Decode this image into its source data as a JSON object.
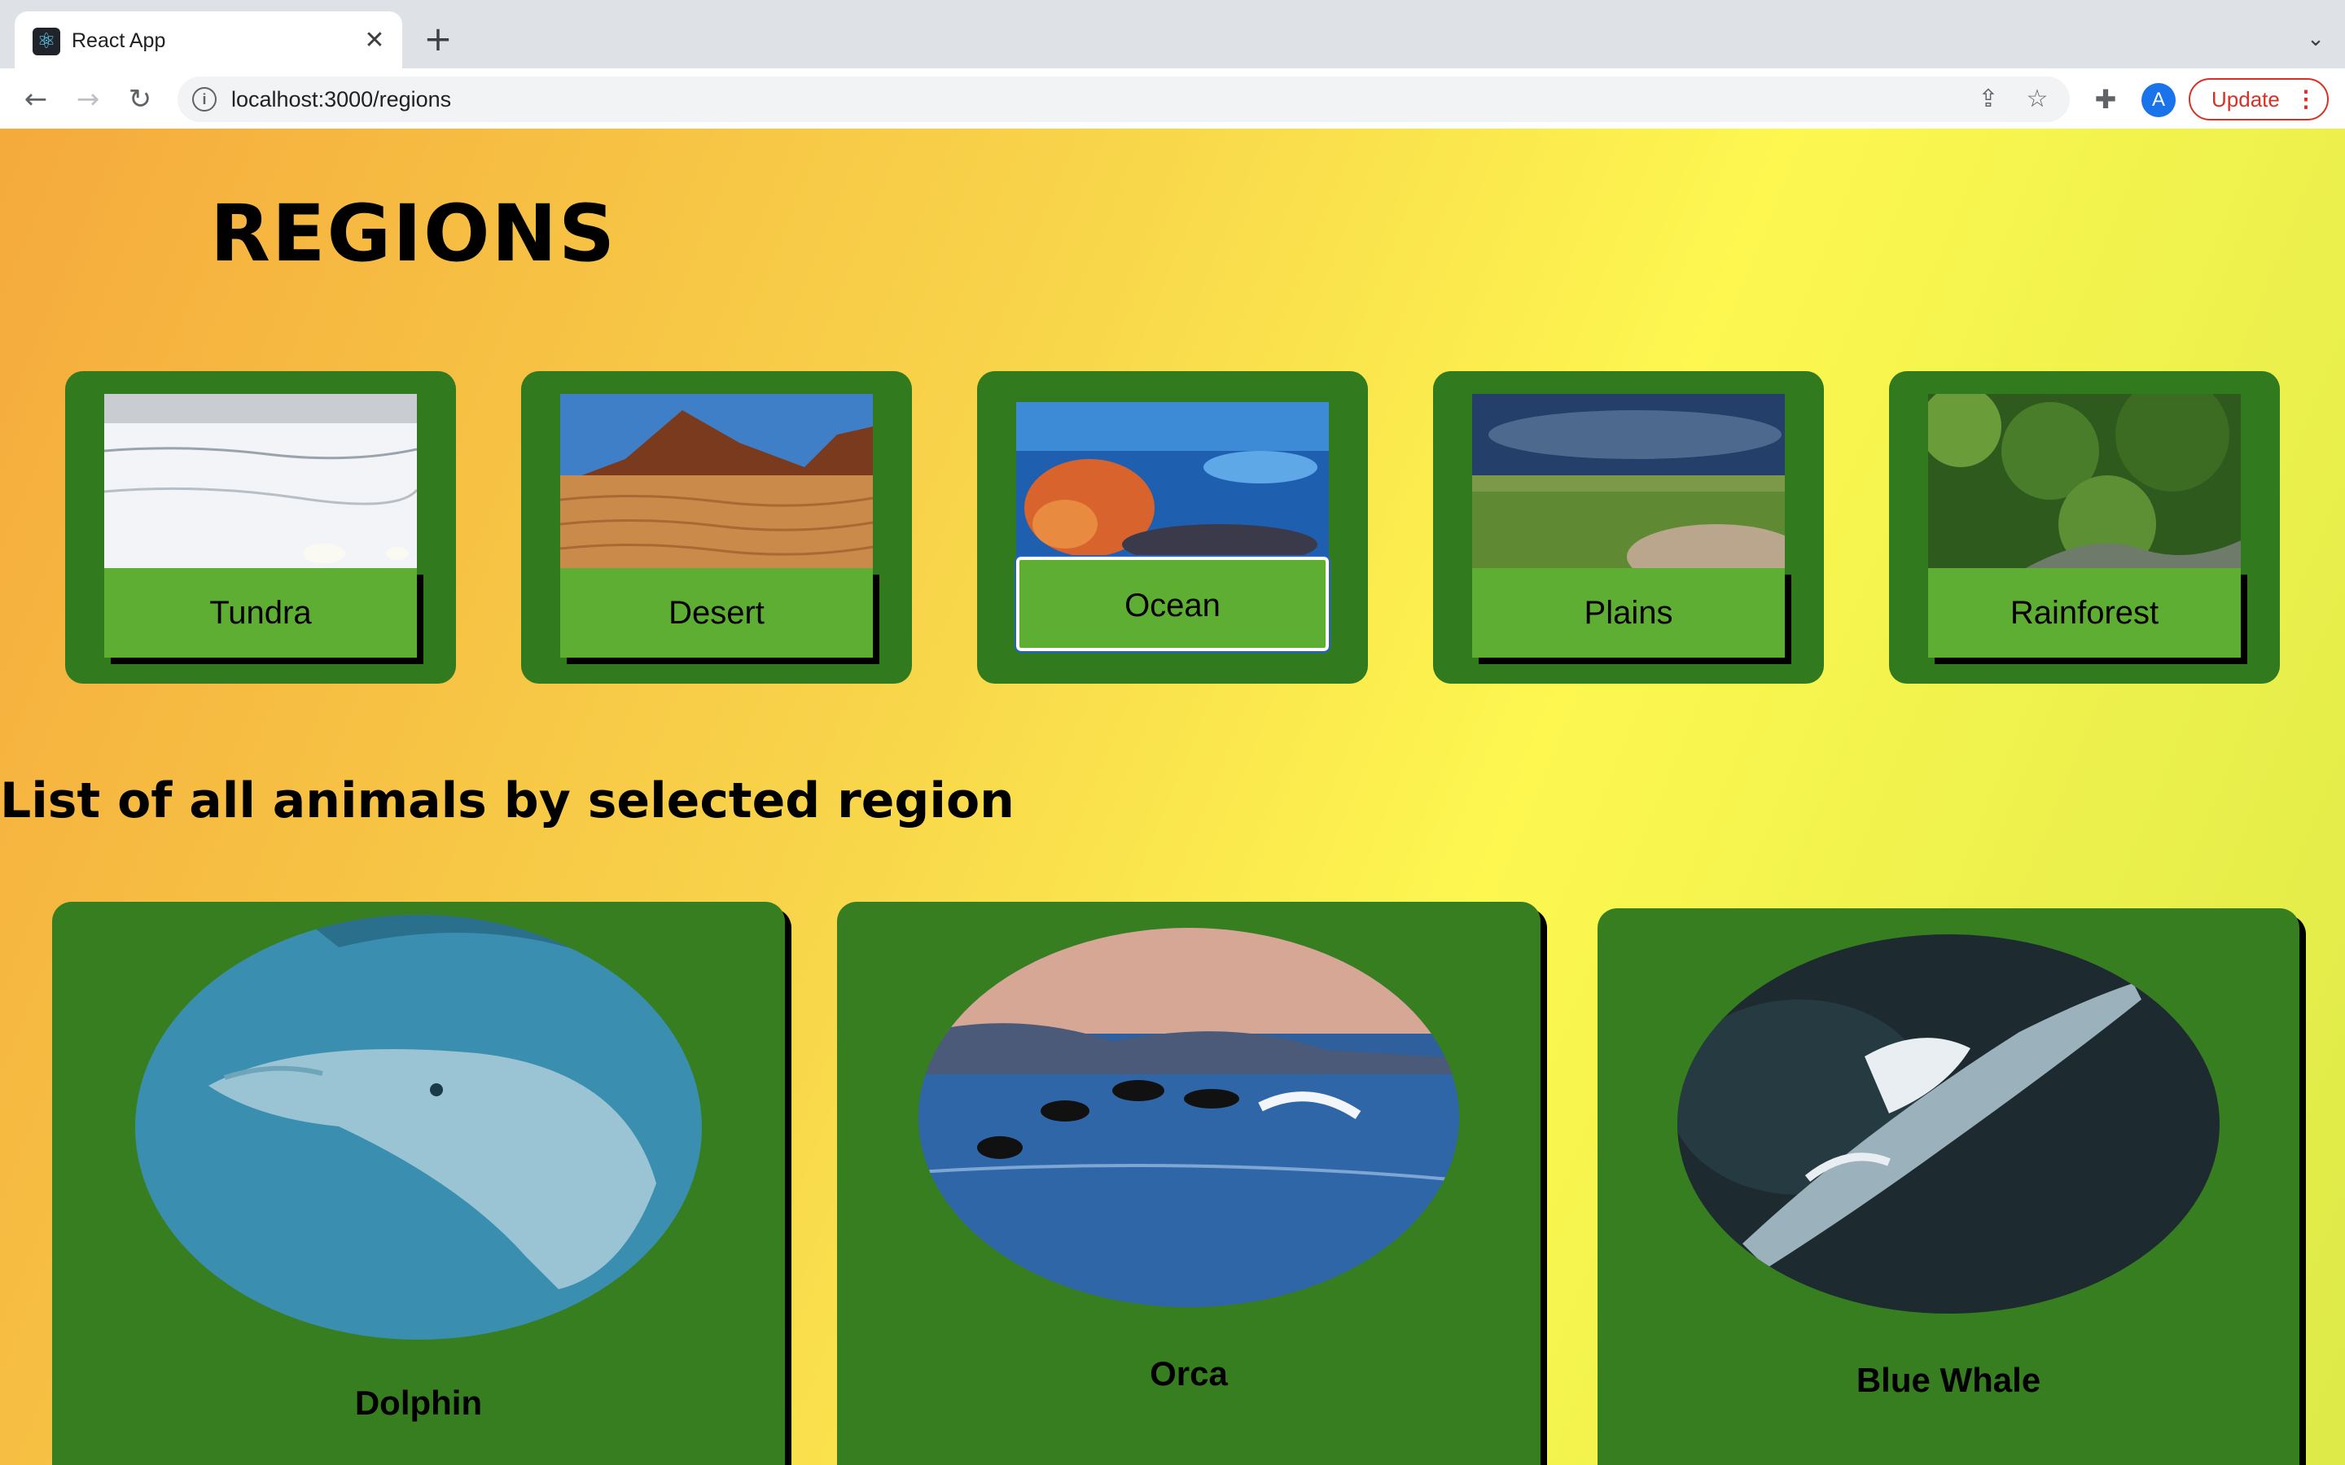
{
  "browser": {
    "tab_title": "React App",
    "tab_close": "✕",
    "new_tab": "+",
    "tab_menu": "⌄",
    "url": "localhost:3000/regions",
    "avatar_letter": "A",
    "update_label": "Update",
    "update_menu": "⋮"
  },
  "page": {
    "title": "REGIONS",
    "section_heading": "List of all animals by selected region"
  },
  "regions": [
    {
      "label": "Tundra",
      "selected": false
    },
    {
      "label": "Desert",
      "selected": false
    },
    {
      "label": "Ocean",
      "selected": true
    },
    {
      "label": "Plains",
      "selected": false
    },
    {
      "label": "Rainforest",
      "selected": false
    }
  ],
  "animals": [
    {
      "name": "Dolphin"
    },
    {
      "name": "Orca"
    },
    {
      "name": "Blue Whale"
    }
  ],
  "colors": {
    "region_card": "#317a1e",
    "region_button": "#5dae32",
    "animal_card": "#377e21",
    "background_gradient": [
      "#f5aa3c",
      "#fdf750",
      "#ddea48"
    ],
    "update_accent": "#d93025"
  }
}
